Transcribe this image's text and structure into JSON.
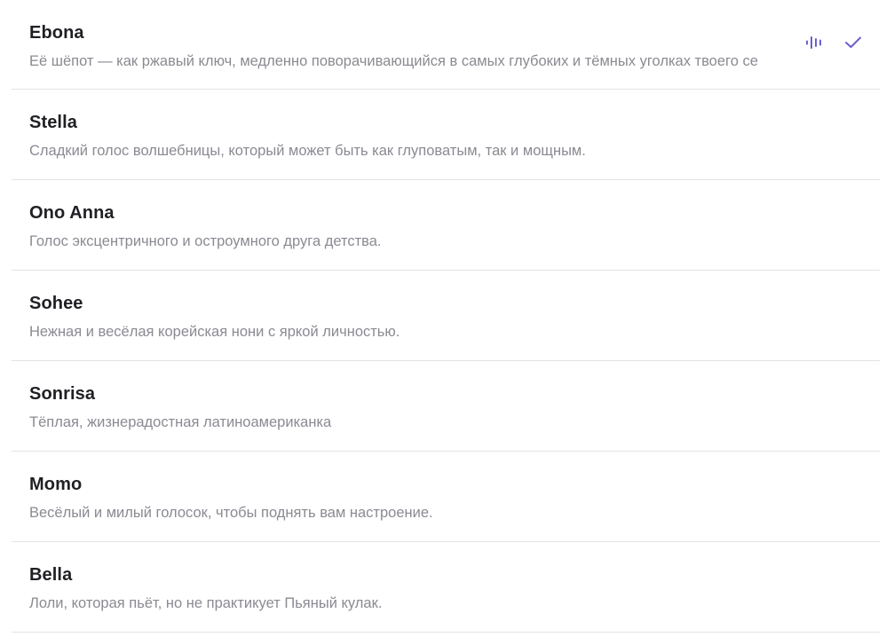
{
  "accent_color": "#6b5fcf",
  "selected_index": 0,
  "voices": [
    {
      "name": "Ebona",
      "description": "Её шёпот — как ржавый ключ, медленно поворачивающийся в самых глубоких и тёмных уголках твоего се",
      "selected": true,
      "icons": [
        "audio-wave-icon",
        "check-icon"
      ]
    },
    {
      "name": "Stella",
      "description": "Сладкий голос волшебницы, который может быть как глуповатым, так и мощным."
    },
    {
      "name": "Ono Anna",
      "description": "Голос эксцентричного и остроумного друга детства."
    },
    {
      "name": "Sohee",
      "description": "Нежная и весёлая корейская нони с яркой личностью."
    },
    {
      "name": "Sonrisa",
      "description": "Тёплая, жизнерадостная латиноамериканка"
    },
    {
      "name": "Momo",
      "description": "Весёлый и милый голосок, чтобы поднять вам настроение."
    },
    {
      "name": "Bella",
      "description": "Лоли, которая пьёт, но не практикует Пьяный кулак."
    }
  ]
}
